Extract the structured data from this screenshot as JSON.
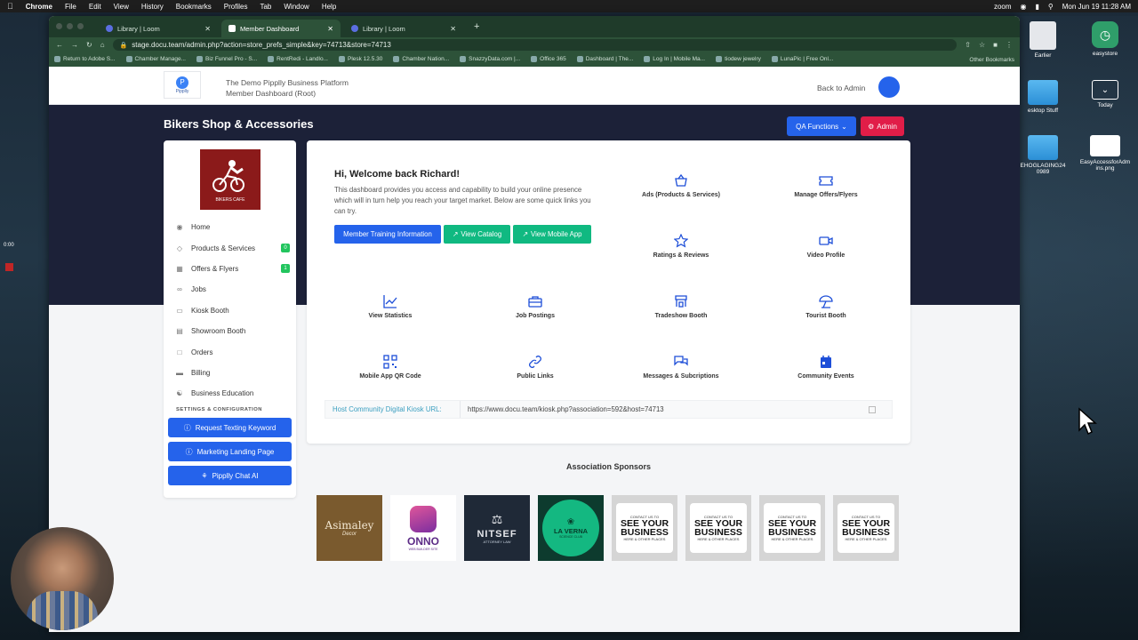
{
  "menubar": {
    "app": "Chrome",
    "items": [
      "File",
      "Edit",
      "View",
      "History",
      "Bookmarks",
      "Profiles",
      "Tab",
      "Window",
      "Help"
    ],
    "zoom": "zoom",
    "clock": "Mon Jun 19  11:28 AM"
  },
  "browser": {
    "tabs": [
      {
        "label": "Library | Loom"
      },
      {
        "label": "Member Dashboard"
      },
      {
        "label": "Library | Loom"
      }
    ],
    "url": "stage.docu.team/admin.php?action=store_prefs_simple&key=74713&store=74713",
    "bookmarks": [
      "Return to Adobe S...",
      "Chamber Manage...",
      "Biz Funnel Pro - S...",
      "RentRedi - Landlo...",
      "Plesk 12.5.30",
      "Chamber Nation...",
      "SnazzyData.com |...",
      "Office 365",
      "Dashboard | The...",
      "Log In | Mobile Ma...",
      "tiodew jewelry",
      "LunaPic | Free Onl..."
    ],
    "other_bookmarks": "Other Bookmarks"
  },
  "site": {
    "logo_text": "Pipplly",
    "platform_name": "The Demo Pipplly Business Platform",
    "platform_sub": "Member Dashboard (Root)",
    "back_to_admin": "Back to Admin",
    "business_title": "Bikers Shop & Accessories",
    "qa_functions": "QA Functions",
    "admin": "Admin"
  },
  "sidebar": {
    "logo_caption": "BIKERS CAFE",
    "items": [
      {
        "label": "Home",
        "icon": "eye-icon"
      },
      {
        "label": "Products & Services",
        "icon": "tag-icon",
        "badge": "0"
      },
      {
        "label": "Offers & Flyers",
        "icon": "gift-icon",
        "badge": "1"
      },
      {
        "label": "Jobs",
        "icon": "link-icon"
      },
      {
        "label": "Kiosk Booth",
        "icon": "monitor-icon"
      },
      {
        "label": "Showroom Booth",
        "icon": "tv-icon"
      },
      {
        "label": "Orders",
        "icon": "cart-icon"
      },
      {
        "label": "Billing",
        "icon": "card-icon"
      },
      {
        "label": "Business Education",
        "icon": "people-icon"
      }
    ],
    "settings_header": "SETTINGS & CONFIGURATION",
    "buttons": [
      "Request Texting Keyword",
      "Marketing Landing Page",
      "Pipplly Chat AI"
    ]
  },
  "main": {
    "welcome": "Hi, Welcome back Richard!",
    "intro": "This dashboard provides you access and capability to build your online presence which will in turn help you reach your target market. Below are some quick links you can try.",
    "actions": [
      "Member Training Information",
      "View Catalog",
      "View Mobile App"
    ],
    "tiles": [
      {
        "label": "Ads (Products & Services)",
        "icon": "basket-icon"
      },
      {
        "label": "Manage Offers/Flyers",
        "icon": "ticket-icon"
      },
      {
        "label": "Ratings & Reviews",
        "icon": "star-icon"
      },
      {
        "label": "Video Profile",
        "icon": "video-icon"
      },
      {
        "label": "View Statistics",
        "icon": "chart-icon"
      },
      {
        "label": "Job Postings",
        "icon": "briefcase-icon"
      },
      {
        "label": "Tradeshow Booth",
        "icon": "booth-icon"
      },
      {
        "label": "Tourist Booth",
        "icon": "umbrella-icon"
      },
      {
        "label": "Mobile App QR Code",
        "icon": "qr-icon"
      },
      {
        "label": "Public Links",
        "icon": "chain-icon"
      },
      {
        "label": "Messages & Subcriptions",
        "icon": "chat-icon"
      },
      {
        "label": "Community Events",
        "icon": "calendar-icon"
      }
    ],
    "kiosk_label": "Host Community Digital Kiosk URL:",
    "kiosk_url": "https://www.docu.team/kiosk.php?association=592&host=74713"
  },
  "sponsors": {
    "title": "Association Sponsors",
    "items": [
      {
        "name": "Asimaley",
        "sub": "Decor"
      },
      {
        "name": "ONNO",
        "sub": "WEB BUILDER SITE"
      },
      {
        "name": "NITSEF",
        "sub": "ATTORNEY LAW"
      },
      {
        "name": "LA VERNA",
        "sub": "SCIENCE CLUB"
      },
      {
        "top": "CONTACT US TO",
        "name": "SEE YOUR BUSINESS",
        "sub": "HERE & OTHER PLACES"
      },
      {
        "top": "CONTACT US TO",
        "name": "SEE YOUR BUSINESS",
        "sub": "HERE & OTHER PLACES"
      },
      {
        "top": "CONTACT US TO",
        "name": "SEE YOUR BUSINESS",
        "sub": "HERE & OTHER PLACES"
      },
      {
        "top": "CONTACT US TO",
        "name": "SEE YOUR BUSINESS",
        "sub": "HERE & OTHER PLACES"
      }
    ]
  },
  "desktop": {
    "icons": [
      {
        "label": "Earlier"
      },
      {
        "label": "easystore"
      },
      {
        "label": "esktop Stuff"
      },
      {
        "label": "Today"
      },
      {
        "label": "EHOGLAGING24 0989"
      },
      {
        "label": "EasyAccessforAdm ins.png"
      }
    ],
    "timer": "0:00"
  }
}
